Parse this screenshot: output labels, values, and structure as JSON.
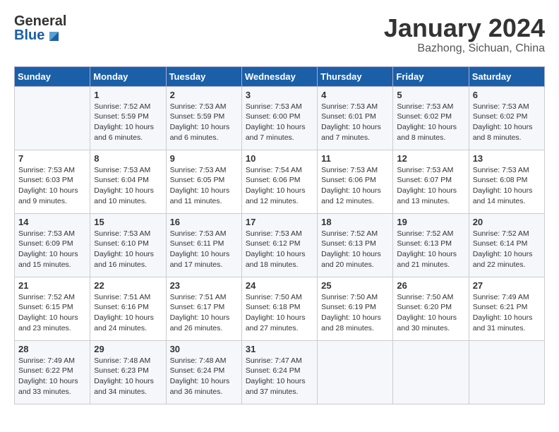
{
  "header": {
    "logo_line1": "General",
    "logo_line2": "Blue",
    "month": "January 2024",
    "location": "Bazhong, Sichuan, China"
  },
  "days_of_week": [
    "Sunday",
    "Monday",
    "Tuesday",
    "Wednesday",
    "Thursday",
    "Friday",
    "Saturday"
  ],
  "weeks": [
    [
      {
        "day": "",
        "info": ""
      },
      {
        "day": "1",
        "info": "Sunrise: 7:52 AM\nSunset: 5:59 PM\nDaylight: 10 hours\nand 6 minutes."
      },
      {
        "day": "2",
        "info": "Sunrise: 7:53 AM\nSunset: 5:59 PM\nDaylight: 10 hours\nand 6 minutes."
      },
      {
        "day": "3",
        "info": "Sunrise: 7:53 AM\nSunset: 6:00 PM\nDaylight: 10 hours\nand 7 minutes."
      },
      {
        "day": "4",
        "info": "Sunrise: 7:53 AM\nSunset: 6:01 PM\nDaylight: 10 hours\nand 7 minutes."
      },
      {
        "day": "5",
        "info": "Sunrise: 7:53 AM\nSunset: 6:02 PM\nDaylight: 10 hours\nand 8 minutes."
      },
      {
        "day": "6",
        "info": "Sunrise: 7:53 AM\nSunset: 6:02 PM\nDaylight: 10 hours\nand 8 minutes."
      }
    ],
    [
      {
        "day": "7",
        "info": "Sunrise: 7:53 AM\nSunset: 6:03 PM\nDaylight: 10 hours\nand 9 minutes."
      },
      {
        "day": "8",
        "info": "Sunrise: 7:53 AM\nSunset: 6:04 PM\nDaylight: 10 hours\nand 10 minutes."
      },
      {
        "day": "9",
        "info": "Sunrise: 7:53 AM\nSunset: 6:05 PM\nDaylight: 10 hours\nand 11 minutes."
      },
      {
        "day": "10",
        "info": "Sunrise: 7:54 AM\nSunset: 6:06 PM\nDaylight: 10 hours\nand 12 minutes."
      },
      {
        "day": "11",
        "info": "Sunrise: 7:53 AM\nSunset: 6:06 PM\nDaylight: 10 hours\nand 12 minutes."
      },
      {
        "day": "12",
        "info": "Sunrise: 7:53 AM\nSunset: 6:07 PM\nDaylight: 10 hours\nand 13 minutes."
      },
      {
        "day": "13",
        "info": "Sunrise: 7:53 AM\nSunset: 6:08 PM\nDaylight: 10 hours\nand 14 minutes."
      }
    ],
    [
      {
        "day": "14",
        "info": "Sunrise: 7:53 AM\nSunset: 6:09 PM\nDaylight: 10 hours\nand 15 minutes."
      },
      {
        "day": "15",
        "info": "Sunrise: 7:53 AM\nSunset: 6:10 PM\nDaylight: 10 hours\nand 16 minutes."
      },
      {
        "day": "16",
        "info": "Sunrise: 7:53 AM\nSunset: 6:11 PM\nDaylight: 10 hours\nand 17 minutes."
      },
      {
        "day": "17",
        "info": "Sunrise: 7:53 AM\nSunset: 6:12 PM\nDaylight: 10 hours\nand 18 minutes."
      },
      {
        "day": "18",
        "info": "Sunrise: 7:52 AM\nSunset: 6:13 PM\nDaylight: 10 hours\nand 20 minutes."
      },
      {
        "day": "19",
        "info": "Sunrise: 7:52 AM\nSunset: 6:13 PM\nDaylight: 10 hours\nand 21 minutes."
      },
      {
        "day": "20",
        "info": "Sunrise: 7:52 AM\nSunset: 6:14 PM\nDaylight: 10 hours\nand 22 minutes."
      }
    ],
    [
      {
        "day": "21",
        "info": "Sunrise: 7:52 AM\nSunset: 6:15 PM\nDaylight: 10 hours\nand 23 minutes."
      },
      {
        "day": "22",
        "info": "Sunrise: 7:51 AM\nSunset: 6:16 PM\nDaylight: 10 hours\nand 24 minutes."
      },
      {
        "day": "23",
        "info": "Sunrise: 7:51 AM\nSunset: 6:17 PM\nDaylight: 10 hours\nand 26 minutes."
      },
      {
        "day": "24",
        "info": "Sunrise: 7:50 AM\nSunset: 6:18 PM\nDaylight: 10 hours\nand 27 minutes."
      },
      {
        "day": "25",
        "info": "Sunrise: 7:50 AM\nSunset: 6:19 PM\nDaylight: 10 hours\nand 28 minutes."
      },
      {
        "day": "26",
        "info": "Sunrise: 7:50 AM\nSunset: 6:20 PM\nDaylight: 10 hours\nand 30 minutes."
      },
      {
        "day": "27",
        "info": "Sunrise: 7:49 AM\nSunset: 6:21 PM\nDaylight: 10 hours\nand 31 minutes."
      }
    ],
    [
      {
        "day": "28",
        "info": "Sunrise: 7:49 AM\nSunset: 6:22 PM\nDaylight: 10 hours\nand 33 minutes."
      },
      {
        "day": "29",
        "info": "Sunrise: 7:48 AM\nSunset: 6:23 PM\nDaylight: 10 hours\nand 34 minutes."
      },
      {
        "day": "30",
        "info": "Sunrise: 7:48 AM\nSunset: 6:24 PM\nDaylight: 10 hours\nand 36 minutes."
      },
      {
        "day": "31",
        "info": "Sunrise: 7:47 AM\nSunset: 6:24 PM\nDaylight: 10 hours\nand 37 minutes."
      },
      {
        "day": "",
        "info": ""
      },
      {
        "day": "",
        "info": ""
      },
      {
        "day": "",
        "info": ""
      }
    ]
  ]
}
